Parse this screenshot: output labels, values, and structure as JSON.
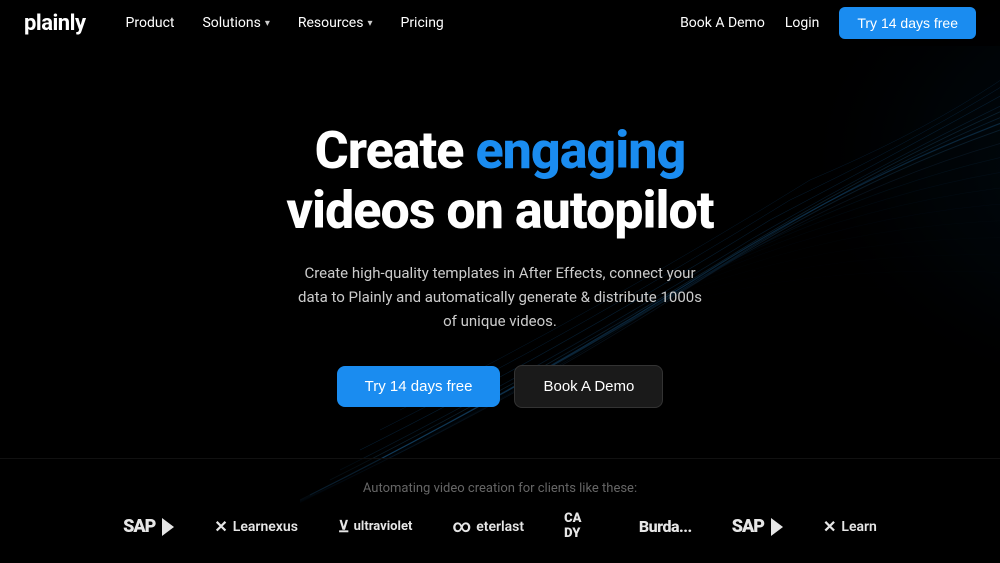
{
  "brand": {
    "logo_text": "plainly"
  },
  "nav": {
    "product_label": "Product",
    "solutions_label": "Solutions",
    "resources_label": "Resources",
    "pricing_label": "Pricing",
    "book_demo_label": "Book A Demo",
    "login_label": "Login",
    "cta_label": "Try 14 days free"
  },
  "hero": {
    "headline_part1": "Create ",
    "headline_accent": "engaging",
    "headline_part2": "videos on autopilot",
    "subtext": "Create high-quality templates in After Effects, connect your data to Plainly and automatically generate & distribute 1000s of unique videos.",
    "cta_primary": "Try 14 days free",
    "cta_secondary": "Book A Demo"
  },
  "clients": {
    "label": "Automating video creation for clients like these:",
    "logos": [
      {
        "id": "sap1",
        "name": "SAP",
        "type": "sap"
      },
      {
        "id": "learnexus",
        "name": "Learnexus",
        "type": "learnexus"
      },
      {
        "id": "ultraviolet",
        "name": "ultraviolet",
        "type": "ultraviolet"
      },
      {
        "id": "eterlast",
        "name": "eterlast",
        "type": "eterlast"
      },
      {
        "id": "cady",
        "name": "CADY",
        "type": "cady"
      },
      {
        "id": "burda",
        "name": "Burda...",
        "type": "burda"
      },
      {
        "id": "sap2",
        "name": "SAP",
        "type": "sap"
      },
      {
        "id": "learnexus2",
        "name": "Learn",
        "type": "learnexus"
      }
    ]
  },
  "colors": {
    "accent": "#1a8cf0",
    "bg": "#000000",
    "text": "#ffffff",
    "muted": "#cccccc",
    "subtle": "#666666"
  }
}
